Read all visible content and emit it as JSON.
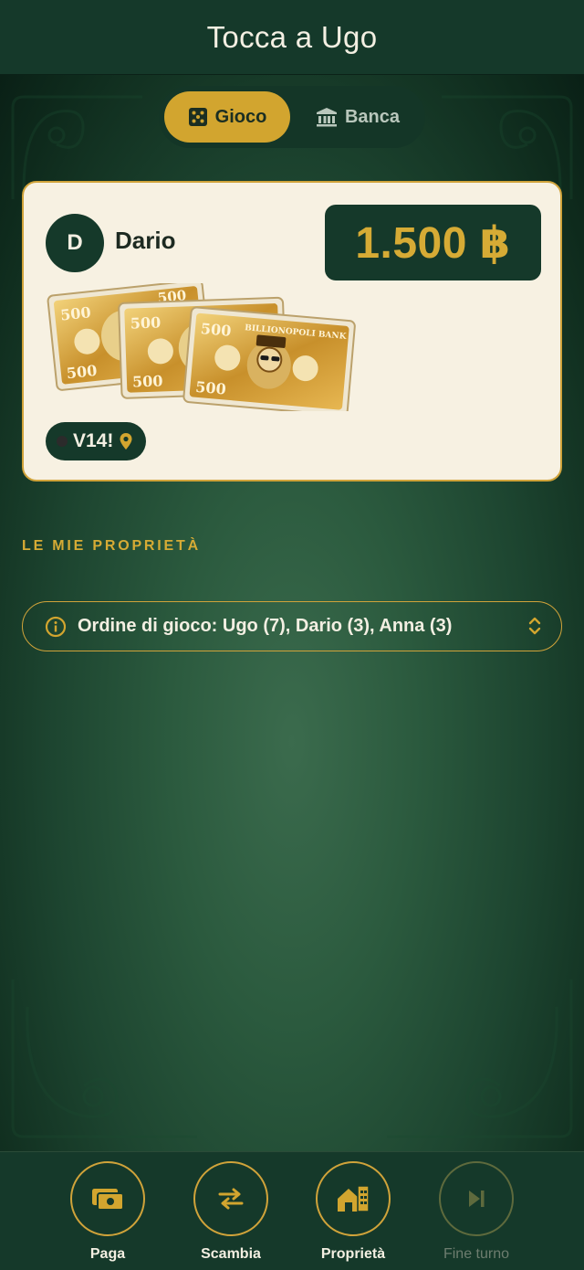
{
  "header": {
    "title": "Tocca a Ugo"
  },
  "tabs": [
    {
      "label": "Gioco",
      "icon": "dice-icon",
      "active": true
    },
    {
      "label": "Banca",
      "icon": "bank-icon",
      "active": false
    }
  ],
  "player": {
    "initial": "D",
    "name": "Dario",
    "balance": "1.500 ฿",
    "banknotes": {
      "denomination": "500",
      "bank_name": "BILLIONOPOLI BANK",
      "count": 3
    },
    "position": {
      "label": "V14!",
      "icon": "location-pin-icon"
    }
  },
  "properties_section": {
    "title": "LE MIE PROPRIETÀ"
  },
  "turn_order": {
    "text": "Ordine di gioco: Ugo (7), Dario (3), Anna (3)",
    "icon": "info-icon"
  },
  "bottom_nav": [
    {
      "label": "Paga",
      "icon": "pay-icon",
      "enabled": true
    },
    {
      "label": "Scambia",
      "icon": "swap-icon",
      "enabled": true
    },
    {
      "label": "Proprietà",
      "icon": "properties-icon",
      "enabled": true
    },
    {
      "label": "Fine turno",
      "icon": "skip-next-icon",
      "enabled": false
    }
  ],
  "colors": {
    "header_bg": "#15392a",
    "gold": "#d2a52f",
    "card_bg": "#f7f1e2",
    "text_light": "#f3efe2"
  }
}
